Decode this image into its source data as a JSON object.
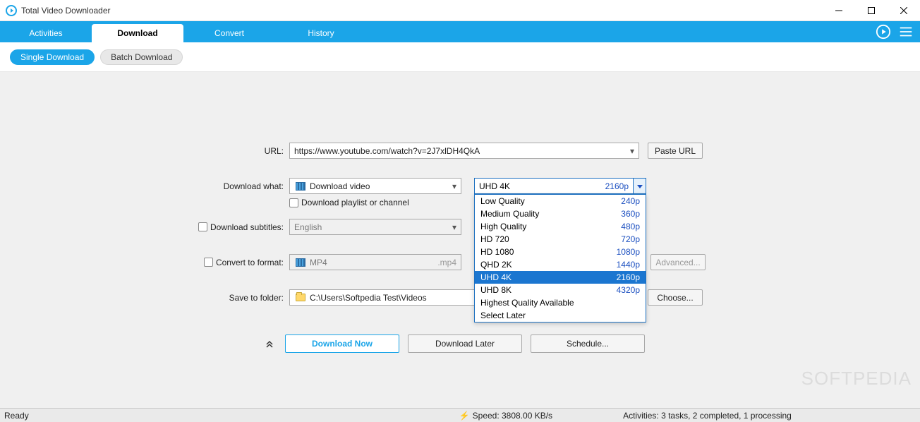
{
  "window": {
    "title": "Total Video Downloader"
  },
  "tabs": {
    "activities": "Activities",
    "download": "Download",
    "convert": "Convert",
    "history": "History"
  },
  "subtabs": {
    "single": "Single Download",
    "batch": "Batch Download"
  },
  "form": {
    "url_label": "URL:",
    "url_value": "https://www.youtube.com/watch?v=2J7xlDH4QkA",
    "paste_url": "Paste URL",
    "download_what_label": "Download what:",
    "download_what_value": "Download video",
    "download_playlist": "Download playlist or channel",
    "download_subtitles": "Download subtitles:",
    "subtitles_value": "English",
    "convert_format": "Convert to format:",
    "format_value": "MP4",
    "format_ext": ".mp4",
    "advanced": "Advanced...",
    "save_folder_label": "Save to folder:",
    "save_folder_value": "C:\\Users\\Softpedia Test\\Videos",
    "choose": "Choose..."
  },
  "quality": {
    "selected_label": "UHD 4K",
    "selected_res": "2160p",
    "options": [
      {
        "label": "Low Quality",
        "res": "240p"
      },
      {
        "label": "Medium Quality",
        "res": "360p"
      },
      {
        "label": "High Quality",
        "res": "480p"
      },
      {
        "label": "HD 720",
        "res": "720p"
      },
      {
        "label": "HD 1080",
        "res": "1080p"
      },
      {
        "label": "QHD 2K",
        "res": "1440p"
      },
      {
        "label": "UHD 4K",
        "res": "2160p"
      },
      {
        "label": "UHD 8K",
        "res": "4320p"
      },
      {
        "label": "Highest Quality Available",
        "res": ""
      },
      {
        "label": "Select Later",
        "res": ""
      }
    ]
  },
  "actions": {
    "download_now": "Download Now",
    "download_later": "Download Later",
    "schedule": "Schedule..."
  },
  "status": {
    "ready": "Ready",
    "speed": "Speed: 3808.00 KB/s",
    "activities": "Activities: 3 tasks, 2 completed, 1 processing"
  },
  "watermark": "SOFTPEDIA"
}
